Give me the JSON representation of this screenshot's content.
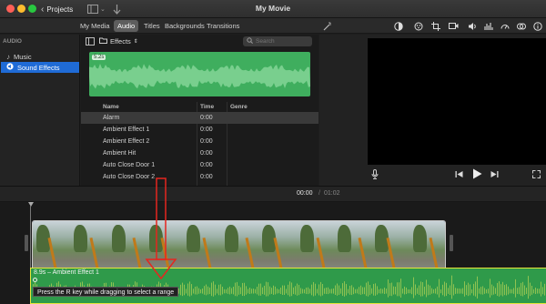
{
  "window": {
    "title": "My Movie",
    "back_button": "Projects",
    "traffic_lights": [
      "#ff5f57",
      "#febc2e",
      "#28c840"
    ]
  },
  "media_tabs": [
    {
      "label": "My Media",
      "active": false
    },
    {
      "label": "Audio",
      "active": true
    },
    {
      "label": "Titles",
      "active": false
    },
    {
      "label": "Backgrounds",
      "active": false
    },
    {
      "label": "Transitions",
      "active": false
    }
  ],
  "viewer_tools": [
    "magic-wand-icon",
    "color-balance-icon",
    "color-correction-icon",
    "crop-icon",
    "camera-stabilize-icon",
    "volume-icon",
    "noise-eq-icon",
    "speed-icon",
    "filter-icon",
    "info-icon"
  ],
  "sidebar": {
    "heading": "AUDIO",
    "items": [
      {
        "label": "Music",
        "icon": "music-note-icon",
        "selected": false
      },
      {
        "label": "Sound Effects",
        "icon": "speaker-icon",
        "selected": true
      }
    ]
  },
  "browser": {
    "source_label": "Effects",
    "search_placeholder": "Search",
    "preview_duration": "5.2s"
  },
  "table": {
    "headers": {
      "name": "Name",
      "time": "Time",
      "genre": "Genre"
    },
    "rows": [
      {
        "name": "Alarm",
        "time": "0:00",
        "genre": "",
        "selected": true
      },
      {
        "name": "Ambient Effect 1",
        "time": "0:00",
        "genre": "",
        "selected": false
      },
      {
        "name": "Ambient Effect 2",
        "time": "0:00",
        "genre": "",
        "selected": false
      },
      {
        "name": "Ambient Hit",
        "time": "0:00",
        "genre": "",
        "selected": false
      },
      {
        "name": "Auto Close Door 1",
        "time": "0:00",
        "genre": "",
        "selected": false
      },
      {
        "name": "Auto Close Door 2",
        "time": "0:00",
        "genre": "",
        "selected": false
      }
    ]
  },
  "timeline": {
    "current_time": "00:00",
    "separator": "/",
    "total_time": "01:02",
    "audio_clip_label": "8.9s – Ambient Effect 1",
    "tooltip": "Press the R key while dragging to select a range"
  },
  "colors": {
    "selection_blue": "#1f6bd6",
    "audio_green": "#3fae5e",
    "annotation_red": "#e5261f",
    "clip_border_yellow": "#e6e63a"
  }
}
